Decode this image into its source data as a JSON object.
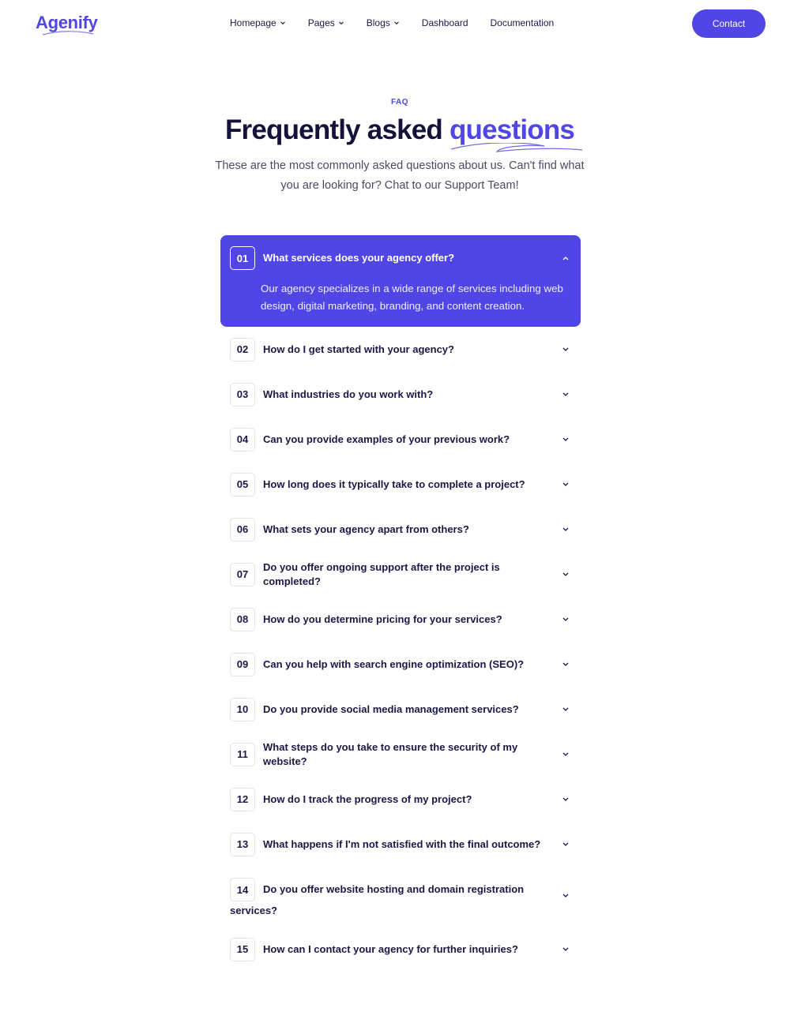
{
  "brand": {
    "name": "Agenify",
    "accent": "#4f46e5",
    "text": "#1b1846"
  },
  "nav": {
    "items": [
      {
        "label": "Homepage",
        "dropdown": true
      },
      {
        "label": "Pages",
        "dropdown": true
      },
      {
        "label": "Blogs",
        "dropdown": true
      },
      {
        "label": "Dashboard",
        "dropdown": false
      },
      {
        "label": "Documentation",
        "dropdown": false
      }
    ],
    "contact_label": "Contact"
  },
  "hero": {
    "eyebrow": "FAQ",
    "title_main": "Frequently asked",
    "title_accent": "questions",
    "subtitle": "These are the most commonly asked questions about us. Can't find what you are looking for? Chat to our Support Team!"
  },
  "faq": {
    "open": {
      "num": "01",
      "question": "What services does your agency offer?",
      "answer": "Our agency specializes in a wide range of services including web design, digital marketing, branding, and content creation."
    },
    "items": [
      {
        "num": "02",
        "question": "How do I get started with your agency?"
      },
      {
        "num": "03",
        "question": "What industries do you work with?"
      },
      {
        "num": "04",
        "question": "Can you provide examples of your previous work?"
      },
      {
        "num": "05",
        "question": "How long does it typically take to complete a project?"
      },
      {
        "num": "06",
        "question": "What sets your agency apart from others?"
      },
      {
        "num": "07",
        "question": "Do you offer ongoing support after the project is completed?"
      },
      {
        "num": "08",
        "question": "How do you determine pricing for your services?"
      },
      {
        "num": "09",
        "question": "Can you help with search engine optimization (SEO)?"
      },
      {
        "num": "10",
        "question": "Do you provide social media management services?"
      },
      {
        "num": "11",
        "question": "What steps do you take to ensure the security of my website?"
      },
      {
        "num": "12",
        "question": "How do I track the progress of my project?"
      },
      {
        "num": "13",
        "question": "What happens if I'm not satisfied with the final outcome?"
      },
      {
        "num": "14",
        "question": "Do you offer website hosting and domain registration",
        "question_cont": "services?"
      },
      {
        "num": "15",
        "question": "How can I contact your agency for further inquiries?"
      }
    ]
  },
  "icons": {
    "collapse": "chevron-up-icon",
    "expand": "chevron-down-icon",
    "nav_dropdown": "chevron-down-icon"
  }
}
